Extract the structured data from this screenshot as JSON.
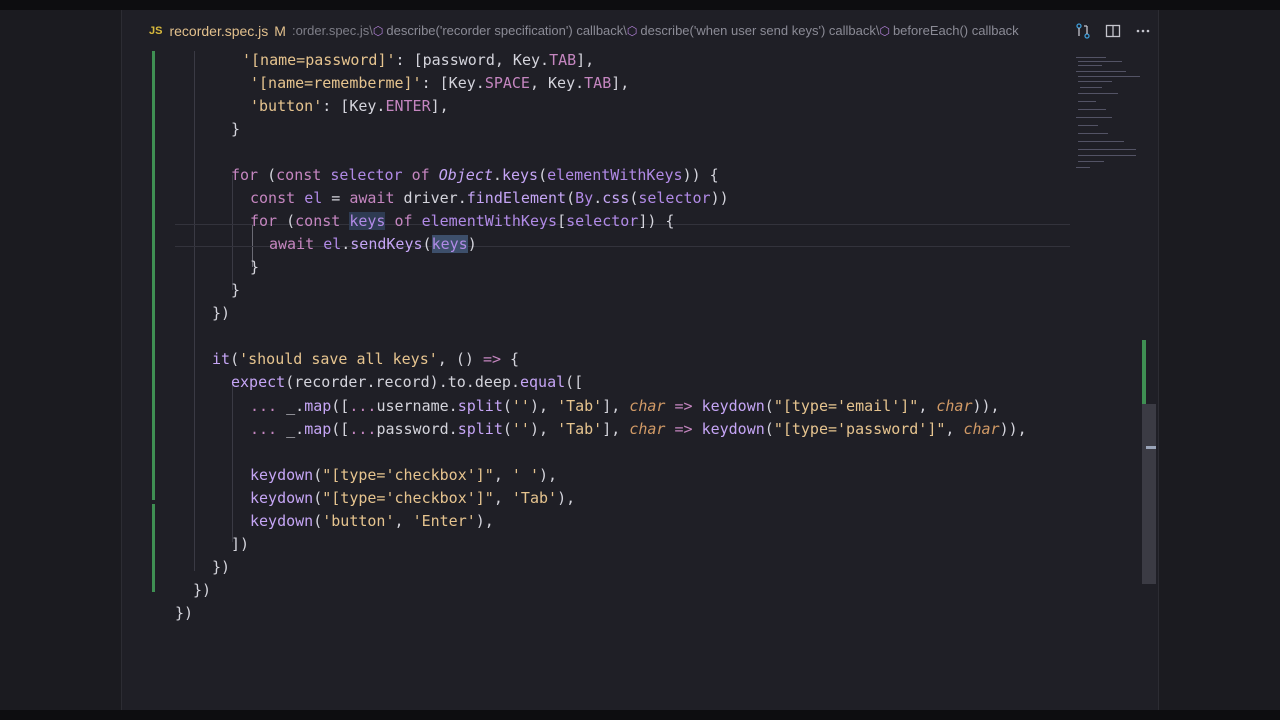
{
  "breadcrumb": {
    "lang_badge": "JS",
    "file_name": "recorder.spec.js",
    "modified_flag": "M",
    "path_fragment": ":order.spec.js\\",
    "items": [
      "describe('recorder specification') callback\\",
      "describe('when user send keys') callback\\",
      "beforeEach() callback"
    ],
    "actions": [
      "compare-changes-icon",
      "split-editor-icon",
      "more-actions-icon"
    ]
  },
  "code": {
    "lines": [
      "    '[name=password]': [password, Key.TAB],",
      "    '[name=rememberme]': [Key.SPACE, Key.TAB],",
      "    'button': [Key.ENTER],",
      "  }",
      "",
      "  for (const selector of Object.keys(elementWithKeys)) {",
      "    const el = await driver.findElement(By.css(selector))",
      "    for (const keys of elementWithKeys[selector]) {",
      "      await el.sendKeys(keys)",
      "    }",
      "  }",
      "})",
      "",
      "it('should save all keys', () => {",
      "  expect(recorder.record).to.deep.equal([",
      "    ... _.map([...username.split(''), 'Tab'], char => keydown(\"[type='email']\", char)),",
      "    ... _.map([...password.split(''), 'Tab'], char => keydown(\"[type='password']\", char)),",
      "",
      "    keydown(\"[type='checkbox']\", ' '),",
      "    keydown(\"[type='checkbox']\", 'Tab'),",
      "    keydown('button', 'Enter'),",
      "  ])",
      "})",
      "})",
      "})"
    ]
  }
}
